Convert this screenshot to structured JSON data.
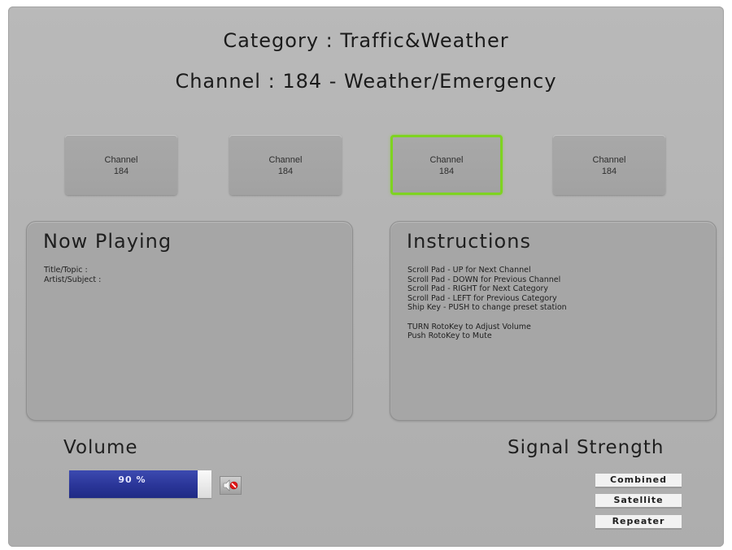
{
  "header": {
    "category": "Category : Traffic&Weather",
    "channel": "Channel : 184 - Weather/Emergency"
  },
  "presets": [
    {
      "line1": "Channel",
      "line2": "184",
      "selected": false
    },
    {
      "line1": "Channel",
      "line2": "184",
      "selected": false
    },
    {
      "line1": "Channel",
      "line2": "184",
      "selected": true
    },
    {
      "line1": "Channel",
      "line2": "184",
      "selected": false
    }
  ],
  "now_playing": {
    "title": "Now Playing",
    "lines": [
      "Title/Topic :",
      "Artist/Subject :"
    ]
  },
  "instructions": {
    "title": "Instructions",
    "lines": [
      "Scroll Pad - UP for Next Channel",
      "Scroll Pad - DOWN for Previous Channel",
      "Scroll Pad - RIGHT for Next Category",
      "Scroll Pad - LEFT for Previous Category",
      "Ship Key - PUSH to change preset station",
      "",
      "TURN RotoKey to Adjust Volume",
      "Push RotoKey to Mute"
    ]
  },
  "volume": {
    "title": "Volume",
    "level_percent": 90,
    "display": "90 %",
    "mute_icon": "speaker-mute-icon"
  },
  "signal": {
    "title": "Signal Strength",
    "labels": [
      "Combined",
      "Satellite",
      "Repeater"
    ]
  },
  "colors": {
    "selected_border": "#7ed321",
    "volume_fill": "#2a3598",
    "background": "#b6b6b6"
  }
}
